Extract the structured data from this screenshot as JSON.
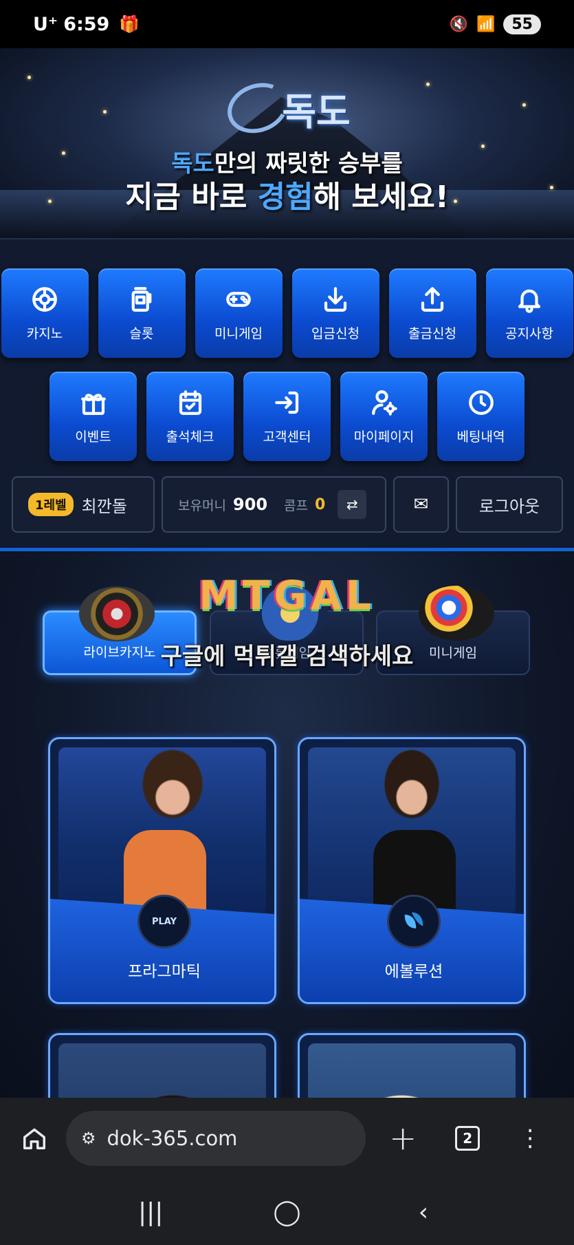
{
  "status_bar": {
    "carrier": "U⁺",
    "time": "6:59",
    "battery": "55"
  },
  "banner": {
    "logo_text": "독도",
    "tagline1_highlight": "독도",
    "tagline1_rest": "만의 짜릿한 승부를",
    "tagline2_pre": "지금 바로 ",
    "tagline2_highlight": "경험",
    "tagline2_post": "해 보세요!"
  },
  "menu": {
    "row1": [
      {
        "label": "카지노",
        "icon": "casino-chip-icon"
      },
      {
        "label": "슬롯",
        "icon": "slot-machine-icon"
      },
      {
        "label": "미니게임",
        "icon": "gamepad-icon"
      },
      {
        "label": "입금신청",
        "icon": "download-icon"
      },
      {
        "label": "출금신청",
        "icon": "upload-icon"
      },
      {
        "label": "공지사항",
        "icon": "bell-icon"
      }
    ],
    "row2": [
      {
        "label": "이벤트",
        "icon": "gift-icon"
      },
      {
        "label": "출석체크",
        "icon": "calendar-check-icon"
      },
      {
        "label": "고객센터",
        "icon": "login-icon"
      },
      {
        "label": "마이페이지",
        "icon": "user-gear-icon"
      },
      {
        "label": "베팅내역",
        "icon": "clock-icon"
      }
    ]
  },
  "user": {
    "level": "1레벨",
    "name": "최깐돌",
    "money_label": "보유머니",
    "money": "900",
    "comp_label": "콤프",
    "comp": "0",
    "swap_icon": "⇄",
    "mail_icon": "✉",
    "logout": "로그아웃"
  },
  "categories": [
    {
      "label": "라이브카지노"
    },
    {
      "label": "슬롯게임"
    },
    {
      "label": "미니게임"
    }
  ],
  "watermark": {
    "logo": "MTGAL",
    "text": "구글에 먹튀갤 검색하세요"
  },
  "providers": [
    {
      "name": "프라그마틱",
      "logo": "PLAY"
    },
    {
      "name": "에볼루션",
      "logo": ""
    }
  ],
  "browser": {
    "url": "dok-365.com",
    "tab_count": "2"
  }
}
